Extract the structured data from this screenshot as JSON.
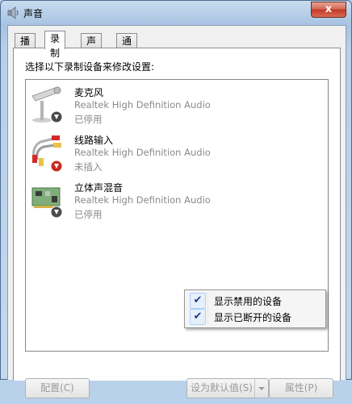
{
  "window": {
    "title": "声音",
    "close_label": "x"
  },
  "tabs": [
    {
      "label": "播放",
      "active": false
    },
    {
      "label": "录制",
      "active": true
    },
    {
      "label": "声音",
      "active": false
    },
    {
      "label": "通信",
      "active": false
    }
  ],
  "instruction": "选择以下录制设备来修改设置:",
  "devices": [
    {
      "name": "麦克风",
      "driver": "Realtek High Definition Audio",
      "status": "已停用",
      "icon": "microphone-icon",
      "badge": "disabled-down-arrow-icon"
    },
    {
      "name": "线路输入",
      "driver": "Realtek High Definition Audio",
      "status": "未插入",
      "icon": "rca-cable-icon",
      "badge": "unplugged-red-arrow-icon"
    },
    {
      "name": "立体声混音",
      "driver": "Realtek High Definition Audio",
      "status": "已停用",
      "icon": "sound-card-icon",
      "badge": "disabled-down-arrow-icon"
    }
  ],
  "context_menu": {
    "items": [
      {
        "label": "显示禁用的设备",
        "checked": true
      },
      {
        "label": "显示已断开的设备",
        "checked": true
      }
    ]
  },
  "buttons": {
    "configure": "配置(C)",
    "set_default": "设为默认值(S)",
    "properties": "属性(P)"
  },
  "colors": {
    "titlebar": "#b9d1ea",
    "close": "#c7402f",
    "status_text": "#8a8a8a",
    "check": "#1b3f8f"
  }
}
